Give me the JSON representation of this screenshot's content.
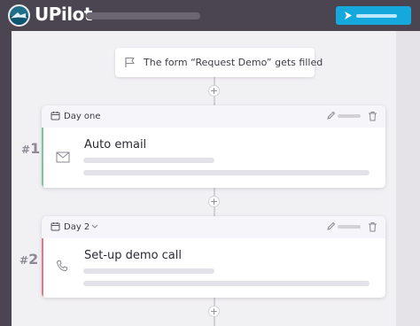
{
  "app": {
    "logo_text": "UPilot"
  },
  "trigger": {
    "text": "The form “Request Demo” gets filled"
  },
  "steps": [
    {
      "number": "1",
      "day_label": "Day one",
      "has_dropdown": false,
      "title": "Auto email",
      "icon": "envelope-icon",
      "accent_color": "#7cc5a3"
    },
    {
      "number": "2",
      "day_label": "Day 2",
      "has_dropdown": true,
      "title": "Set-up demo call",
      "icon": "phone-icon",
      "accent_color": "#e07b86"
    }
  ],
  "colors": {
    "cta": "#14a8dd",
    "header": "#4a4550",
    "canvas": "#f1f0f3"
  }
}
